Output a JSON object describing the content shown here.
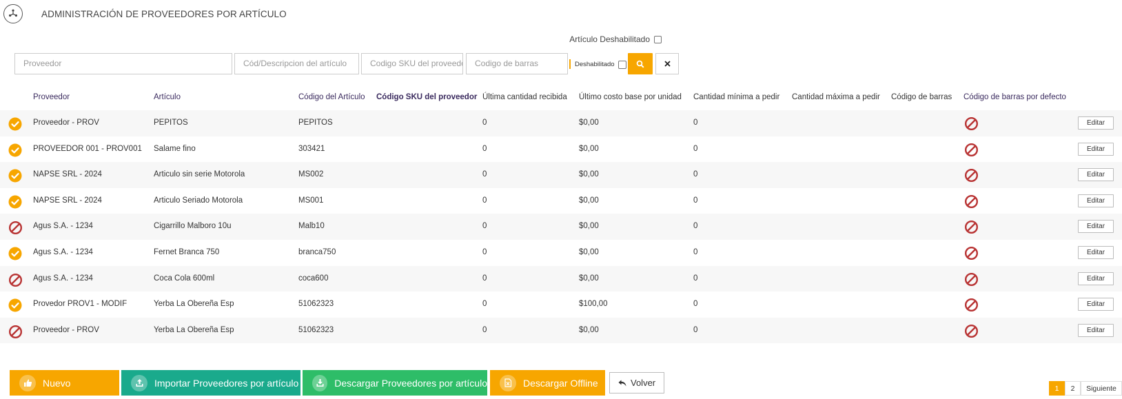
{
  "header": {
    "title": "ADMINISTRACIÓN DE PROVEEDORES POR ARTÍCULO"
  },
  "top_filter": {
    "label": "Artículo Deshabilitado"
  },
  "filters": {
    "proveedor_placeholder": "Proveedor",
    "articulo_placeholder": "Cód/Descripcion del artículo",
    "sku_placeholder": "Codigo SKU del proveedor",
    "barcode_placeholder": "Codigo de barras",
    "disabled_label": "Deshabilitado"
  },
  "table": {
    "columns": [
      "Proveedor",
      "Artículo",
      "Código del Artículo",
      "Código SKU del proveedor",
      "Última cantidad recibida",
      "Último costo base por unidad",
      "Cantidad mínima a pedir",
      "Cantidad máxima a pedir",
      "Código de barras",
      "Código de barras por defecto"
    ],
    "edit_label": "Editar",
    "rows": [
      {
        "status": "ok",
        "proveedor": "Proveedor - PROV",
        "articulo": "PEPITOS",
        "codigo": "PEPITOS",
        "sku": "",
        "ultima_cant": "0",
        "ultimo_costo": "$0,00",
        "cant_min": "0",
        "cant_max": "",
        "barcode": ""
      },
      {
        "status": "ok",
        "proveedor": "PROVEEDOR 001 - PROV001",
        "articulo": "Salame fino",
        "codigo": "303421",
        "sku": "",
        "ultima_cant": "0",
        "ultimo_costo": "$0,00",
        "cant_min": "0",
        "cant_max": "",
        "barcode": ""
      },
      {
        "status": "ok",
        "proveedor": "NAPSE SRL - 2024",
        "articulo": "Articulo sin serie Motorola",
        "codigo": "MS002",
        "sku": "",
        "ultima_cant": "0",
        "ultimo_costo": "$0,00",
        "cant_min": "0",
        "cant_max": "",
        "barcode": ""
      },
      {
        "status": "ok",
        "proveedor": "NAPSE SRL - 2024",
        "articulo": "Articulo Seriado Motorola",
        "codigo": "MS001",
        "sku": "",
        "ultima_cant": "0",
        "ultimo_costo": "$0,00",
        "cant_min": "0",
        "cant_max": "",
        "barcode": ""
      },
      {
        "status": "ban",
        "proveedor": "Agus S.A. - 1234",
        "articulo": "Cigarrillo Malboro 10u",
        "codigo": "Malb10",
        "sku": "",
        "ultima_cant": "0",
        "ultimo_costo": "$0,00",
        "cant_min": "0",
        "cant_max": "",
        "barcode": ""
      },
      {
        "status": "ok",
        "proveedor": "Agus S.A. - 1234",
        "articulo": "Fernet Branca 750",
        "codigo": "branca750",
        "sku": "",
        "ultima_cant": "0",
        "ultimo_costo": "$0,00",
        "cant_min": "0",
        "cant_max": "",
        "barcode": ""
      },
      {
        "status": "ban",
        "proveedor": "Agus S.A. - 1234",
        "articulo": "Coca Cola 600ml",
        "codigo": "coca600",
        "sku": "",
        "ultima_cant": "0",
        "ultimo_costo": "$0,00",
        "cant_min": "0",
        "cant_max": "",
        "barcode": ""
      },
      {
        "status": "ok",
        "proveedor": "Provedor PROV1 - MODIF",
        "articulo": "Yerba La Obereña Esp",
        "codigo": "51062323",
        "sku": "",
        "ultima_cant": "0",
        "ultimo_costo": "$100,00",
        "cant_min": "0",
        "cant_max": "",
        "barcode": ""
      },
      {
        "status": "ban",
        "proveedor": "Proveedor - PROV",
        "articulo": "Yerba La Obereña Esp",
        "codigo": "51062323",
        "sku": "",
        "ultima_cant": "0",
        "ultimo_costo": "$0,00",
        "cant_min": "0",
        "cant_max": "",
        "barcode": ""
      }
    ]
  },
  "actions": {
    "nuevo": "Nuevo",
    "importar": "Importar Proveedores por artículo",
    "descargar": "Descargar Proveedores por artículo",
    "offline": "Descargar Offline",
    "volver": "Volver"
  },
  "pagination": {
    "pages": [
      "1",
      "2"
    ],
    "next": "Siguiente",
    "current": "1"
  },
  "colors": {
    "accent": "#f7a600",
    "import_green": "#1aaa8c",
    "download_green": "#2ebd68",
    "ban_red": "#b83232"
  }
}
